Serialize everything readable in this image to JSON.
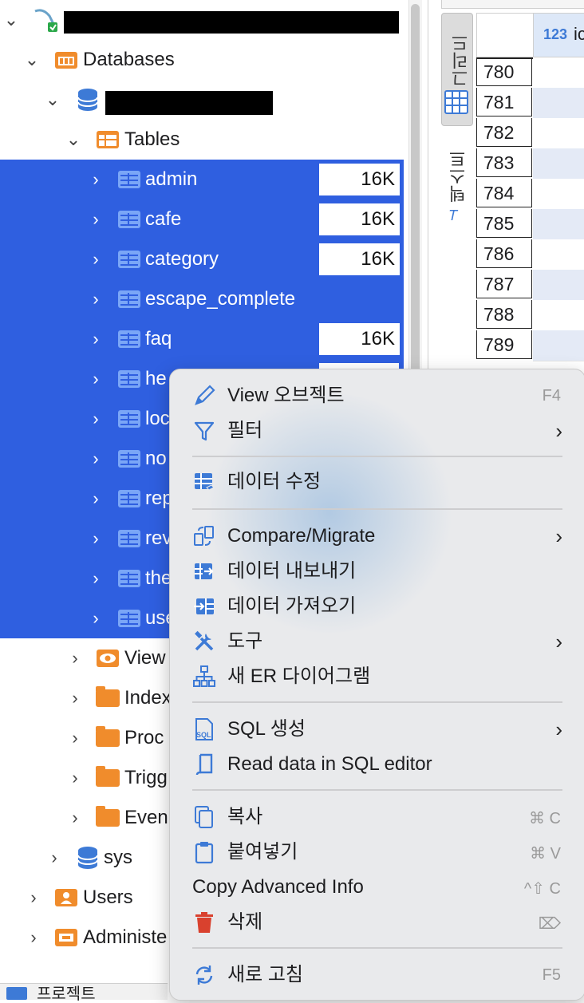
{
  "navigator": {
    "databases_label": "Databases",
    "tables_label": "Tables",
    "tables": [
      {
        "name": "admin",
        "size": "16K"
      },
      {
        "name": "cafe",
        "size": "16K"
      },
      {
        "name": "category",
        "size": "16K"
      },
      {
        "name": "escape_complete",
        "size": ""
      },
      {
        "name": "faq",
        "size": "16K"
      },
      {
        "name": "he",
        "size": ""
      },
      {
        "name": "loc",
        "size": ""
      },
      {
        "name": "no",
        "size": ""
      },
      {
        "name": "rep",
        "size": ""
      },
      {
        "name": "rev",
        "size": ""
      },
      {
        "name": "the",
        "size": ""
      },
      {
        "name": "use",
        "size": ""
      }
    ],
    "folders": [
      "View",
      "Index",
      "Proc",
      "Trigg",
      "Even"
    ],
    "sys_label": "sys",
    "users_label": "Users",
    "administer_label": "Administe",
    "bottom_tab_label": "프로젝트"
  },
  "grid_panel": {
    "grid_tab_label": "그리드",
    "text_tab_label": "텍스트",
    "column_header_type": "123",
    "column_header_name": "ic",
    "row_numbers": [
      "780",
      "781",
      "782",
      "783",
      "784",
      "785",
      "786",
      "787",
      "788",
      "789"
    ]
  },
  "context_menu": {
    "items": [
      {
        "label": "View 오브젝트",
        "shortcut": "F4",
        "icon": "pencil-icon"
      },
      {
        "label": "필터",
        "submenu": true,
        "icon": "filter-icon"
      },
      {
        "label": "데이터 수정",
        "icon": "edit-data-icon"
      },
      {
        "label": "Compare/Migrate",
        "submenu": true,
        "icon": "compare-icon"
      },
      {
        "label": "데이터 내보내기",
        "icon": "export-icon"
      },
      {
        "label": "데이터 가져오기",
        "icon": "import-icon"
      },
      {
        "label": "도구",
        "submenu": true,
        "icon": "tools-icon"
      },
      {
        "label": "새 ER 다이어그램",
        "icon": "er-diagram-icon"
      },
      {
        "label": "SQL 생성",
        "submenu": true,
        "icon": "sql-icon"
      },
      {
        "label": "Read data in SQL editor",
        "icon": "sql-editor-icon"
      },
      {
        "label": "복사",
        "shortcut": "⌘ C",
        "icon": "copy-icon"
      },
      {
        "label": "붙여넣기",
        "shortcut": "⌘ V",
        "icon": "paste-icon"
      },
      {
        "label": "Copy Advanced Info",
        "shortcut": "^⇧ C"
      },
      {
        "label": "삭제",
        "shortcut": "⌦",
        "icon": "trash-icon"
      },
      {
        "label": "새로 고침",
        "shortcut": "F5",
        "icon": "refresh-icon"
      }
    ]
  },
  "colors": {
    "selection": "#2f5fe0",
    "folder": "#f08c2c",
    "delete_red": "#d9412e",
    "icon_blue": "#3d7ad6"
  }
}
